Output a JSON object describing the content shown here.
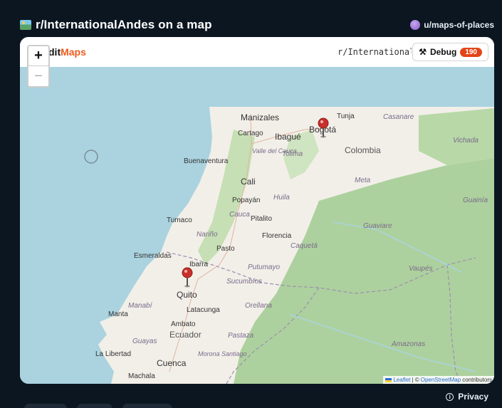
{
  "post": {
    "title": "r/InternationalAndes on a map",
    "author": "u/maps-of-places"
  },
  "map_card": {
    "brand_prefix": "dit",
    "brand_accent": "Maps",
    "subreddit": "r/International",
    "debug_label": "Debug",
    "debug_count": "190",
    "zoom_in": "+",
    "zoom_out": "−",
    "attribution_leaflet": "Leaflet",
    "attribution_sep": " | © ",
    "attribution_osm": "OpenStreetMap",
    "attribution_suffix": " contributors"
  },
  "map": {
    "places": {
      "manizales": "Manizales",
      "tunja": "Tunja",
      "casanare": "Casanare",
      "cartago": "Cartago",
      "ibague": "Ibagué",
      "bogota": "Bogotá",
      "vichada": "Vichada",
      "valle_del_cauca": "Valle del Cauca",
      "tolima": "Tolima",
      "colombia": "Colombia",
      "buenaventura": "Buenaventura",
      "meta": "Meta",
      "cali": "Cali",
      "popayan": "Popayán",
      "huila": "Huila",
      "guainia": "Guainía",
      "tumaco": "Tumaco",
      "cauca": "Cauca",
      "pitalito": "Pitalito",
      "guaviare": "Guaviare",
      "narino": "Nariño",
      "florencia": "Florencia",
      "pasto": "Pasto",
      "caqueta": "Caquetá",
      "esmeraldas": "Esmeraldas",
      "ibarra": "Ibarra",
      "putumayo": "Putumayo",
      "vaupes": "Vaupés",
      "sucumbios": "Sucumbíos",
      "quito": "Quito",
      "manabi": "Manabí",
      "latacunga": "Latacunga",
      "orellana": "Orellana",
      "manta": "Manta",
      "ambato": "Ambato",
      "ecuador": "Ecuador",
      "pastaza": "Pastaza",
      "guayas": "Guayas",
      "amazonas": "Amazonas",
      "la_libertad": "La Libertad",
      "morona_santiago": "Morona Santiago",
      "cuenca": "Cuenca",
      "machala": "Machala"
    },
    "colors": {
      "water": "#aad3df",
      "land": "#f2efe9",
      "forest": "#add19e",
      "marker": "#c9302c"
    }
  },
  "footer": {
    "privacy": "Privacy"
  }
}
